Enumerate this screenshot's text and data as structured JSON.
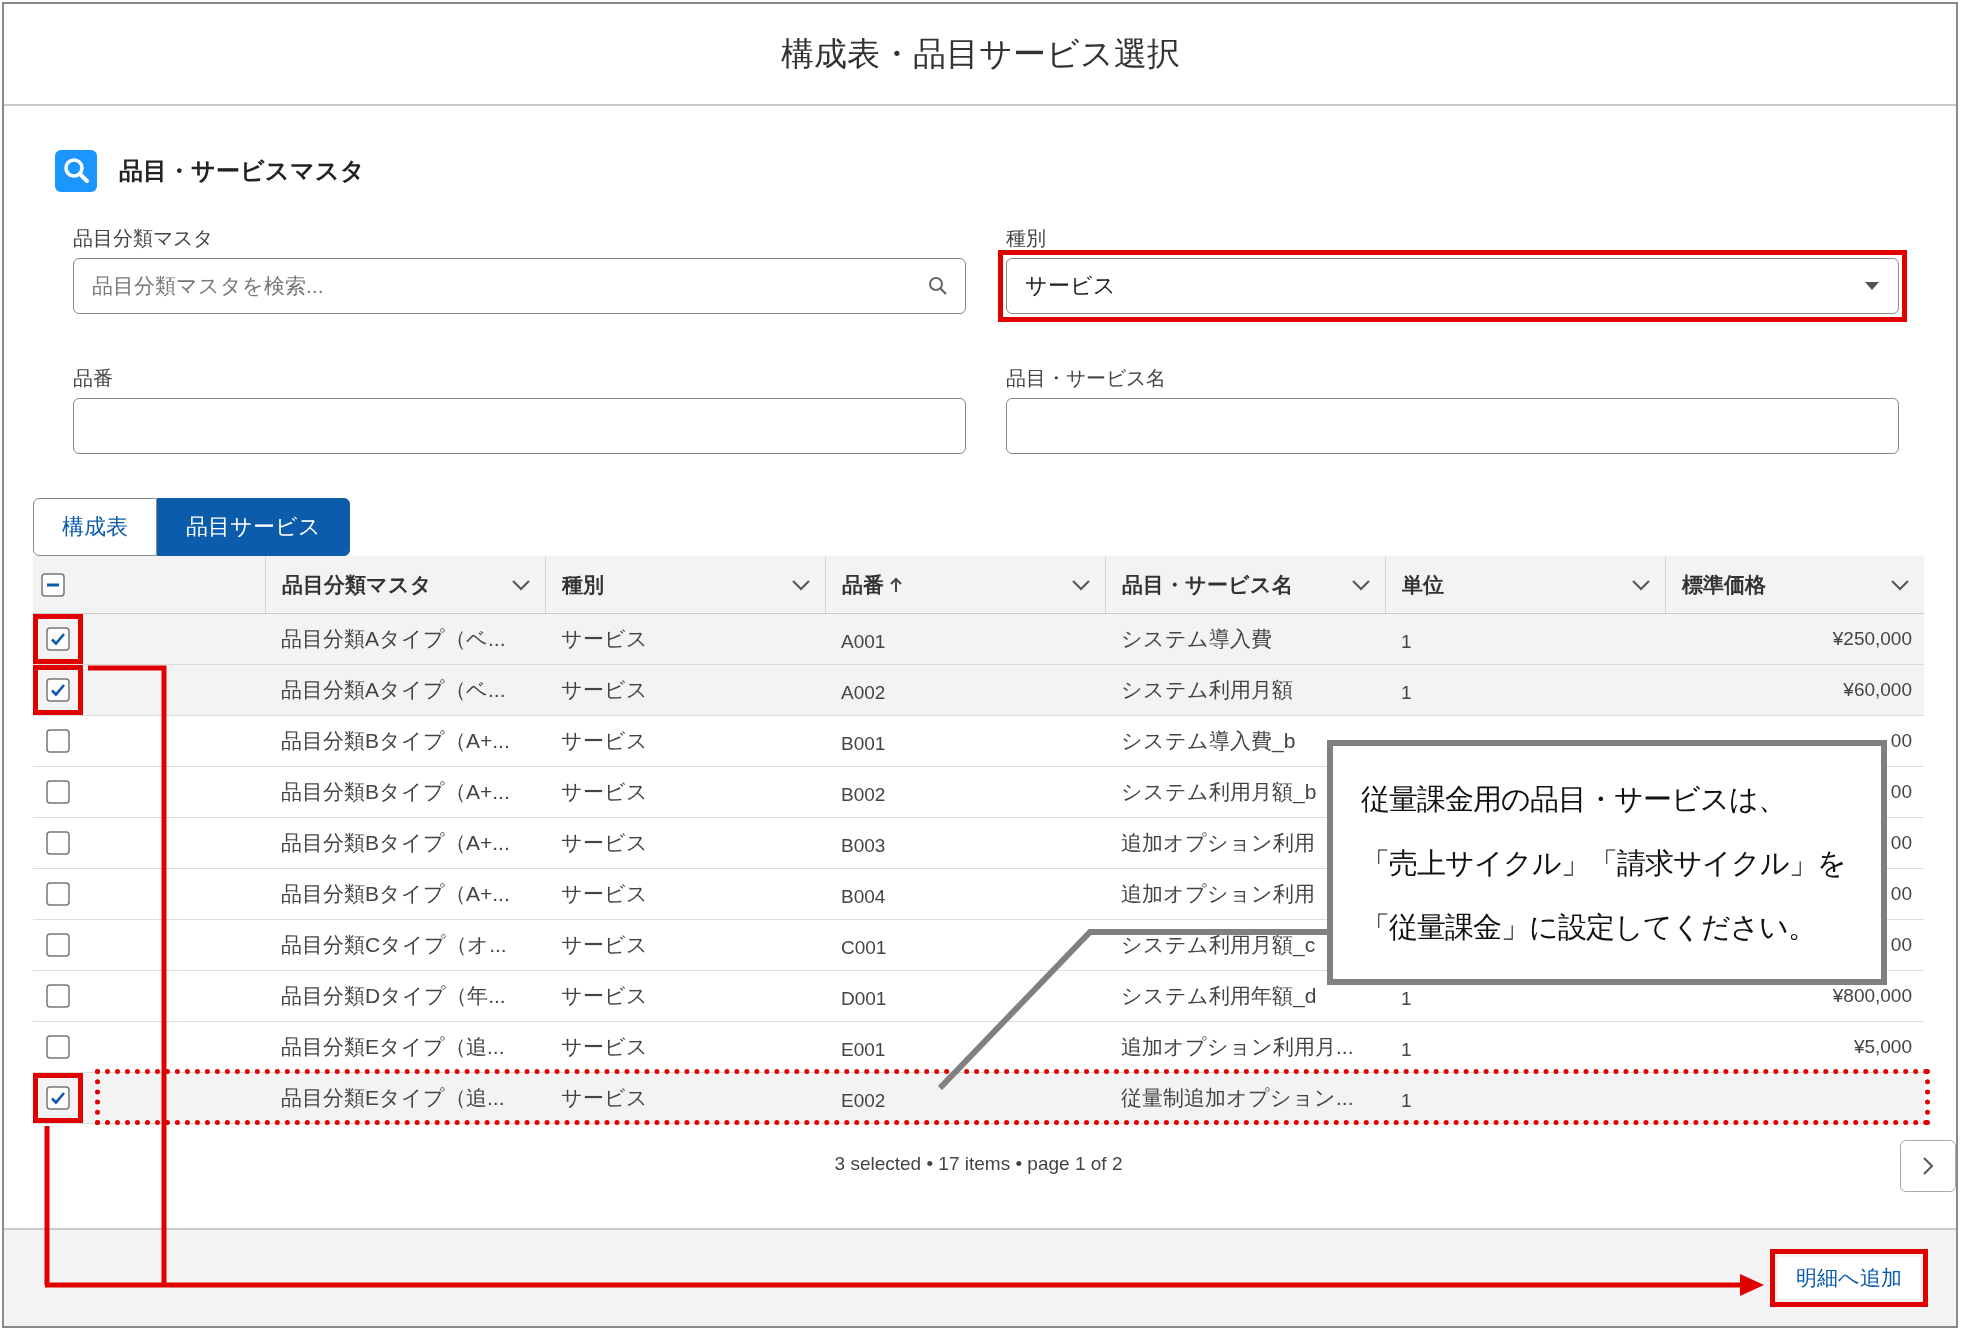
{
  "window": {
    "title": "構成表・品目サービス選択"
  },
  "section": {
    "title": "品目・サービスマスタ"
  },
  "filters": [
    {
      "label": "品目分類マスタ",
      "kind": "search",
      "placeholder": "品目分類マスタを検索...",
      "highlighted": false
    },
    {
      "label": "種別",
      "kind": "select",
      "value": "サービス",
      "highlighted": true
    },
    {
      "label": "品番",
      "kind": "text",
      "highlighted": false
    },
    {
      "label": "品目・サービス名",
      "kind": "text",
      "highlighted": false
    }
  ],
  "tabs": [
    {
      "label": "構成表",
      "selected": false
    },
    {
      "label": "品目サービス",
      "selected": true
    }
  ],
  "table": {
    "select_all_partial": true,
    "columns": [
      {
        "label": "品目分類マスタ",
        "sorted_ascending": false
      },
      {
        "label": "種別",
        "sorted_ascending": false
      },
      {
        "label": "品番",
        "sorted_ascending": true
      },
      {
        "label": "品目・サービス名",
        "sorted_ascending": false
      },
      {
        "label": "単位",
        "sorted_ascending": false
      },
      {
        "label": "標準価格",
        "sorted_ascending": false
      }
    ],
    "rows": [
      {
        "checked": true,
        "checkbox_highlighted": true,
        "row_highlighted": false,
        "cells": [
          "品目分類Aタイプ（ベ...",
          "サービス",
          "A001",
          "システム導入費",
          "1",
          "¥250,000"
        ]
      },
      {
        "checked": true,
        "checkbox_highlighted": true,
        "row_highlighted": false,
        "cells": [
          "品目分類Aタイプ（ベ...",
          "サービス",
          "A002",
          "システム利用月額",
          "1",
          "¥60,000"
        ]
      },
      {
        "checked": false,
        "checkbox_highlighted": false,
        "row_highlighted": false,
        "cells": [
          "品目分類Bタイプ（A+...",
          "サービス",
          "B001",
          "システム導入費_b",
          "",
          "00"
        ]
      },
      {
        "checked": false,
        "checkbox_highlighted": false,
        "row_highlighted": false,
        "cells": [
          "品目分類Bタイプ（A+...",
          "サービス",
          "B002",
          "システム利用月額_b",
          "",
          "00"
        ]
      },
      {
        "checked": false,
        "checkbox_highlighted": false,
        "row_highlighted": false,
        "cells": [
          "品目分類Bタイプ（A+...",
          "サービス",
          "B003",
          "追加オプション利用",
          "",
          "00"
        ]
      },
      {
        "checked": false,
        "checkbox_highlighted": false,
        "row_highlighted": false,
        "cells": [
          "品目分類Bタイプ（A+...",
          "サービス",
          "B004",
          "追加オプション利用",
          "",
          "00"
        ]
      },
      {
        "checked": false,
        "checkbox_highlighted": false,
        "row_highlighted": false,
        "cells": [
          "品目分類Cタイプ（オ...",
          "サービス",
          "C001",
          "システム利用月額_c",
          "",
          "00"
        ]
      },
      {
        "checked": false,
        "checkbox_highlighted": false,
        "row_highlighted": false,
        "cells": [
          "品目分類Dタイプ（年...",
          "サービス",
          "D001",
          "システム利用年額_d",
          "1",
          "¥800,000"
        ]
      },
      {
        "checked": false,
        "checkbox_highlighted": false,
        "row_highlighted": false,
        "cells": [
          "品目分類Eタイプ（追...",
          "サービス",
          "E001",
          "追加オプション利用月...",
          "1",
          "¥5,000"
        ]
      },
      {
        "checked": true,
        "checkbox_highlighted": true,
        "row_highlighted": true,
        "cells": [
          "品目分類Eタイプ（追...",
          "サービス",
          "E002",
          "従量制追加オプション...",
          "1",
          ""
        ]
      }
    ],
    "status": "3 selected • 17 items • page 1 of 2"
  },
  "footer": {
    "button": {
      "label": "明細へ追加",
      "highlighted": true
    }
  },
  "callout": {
    "lines": [
      "従量課金用の品目・サービスは、",
      "「売上サイクル」「請求サイクル」を",
      "「従量課金」に設定してください。"
    ]
  }
}
